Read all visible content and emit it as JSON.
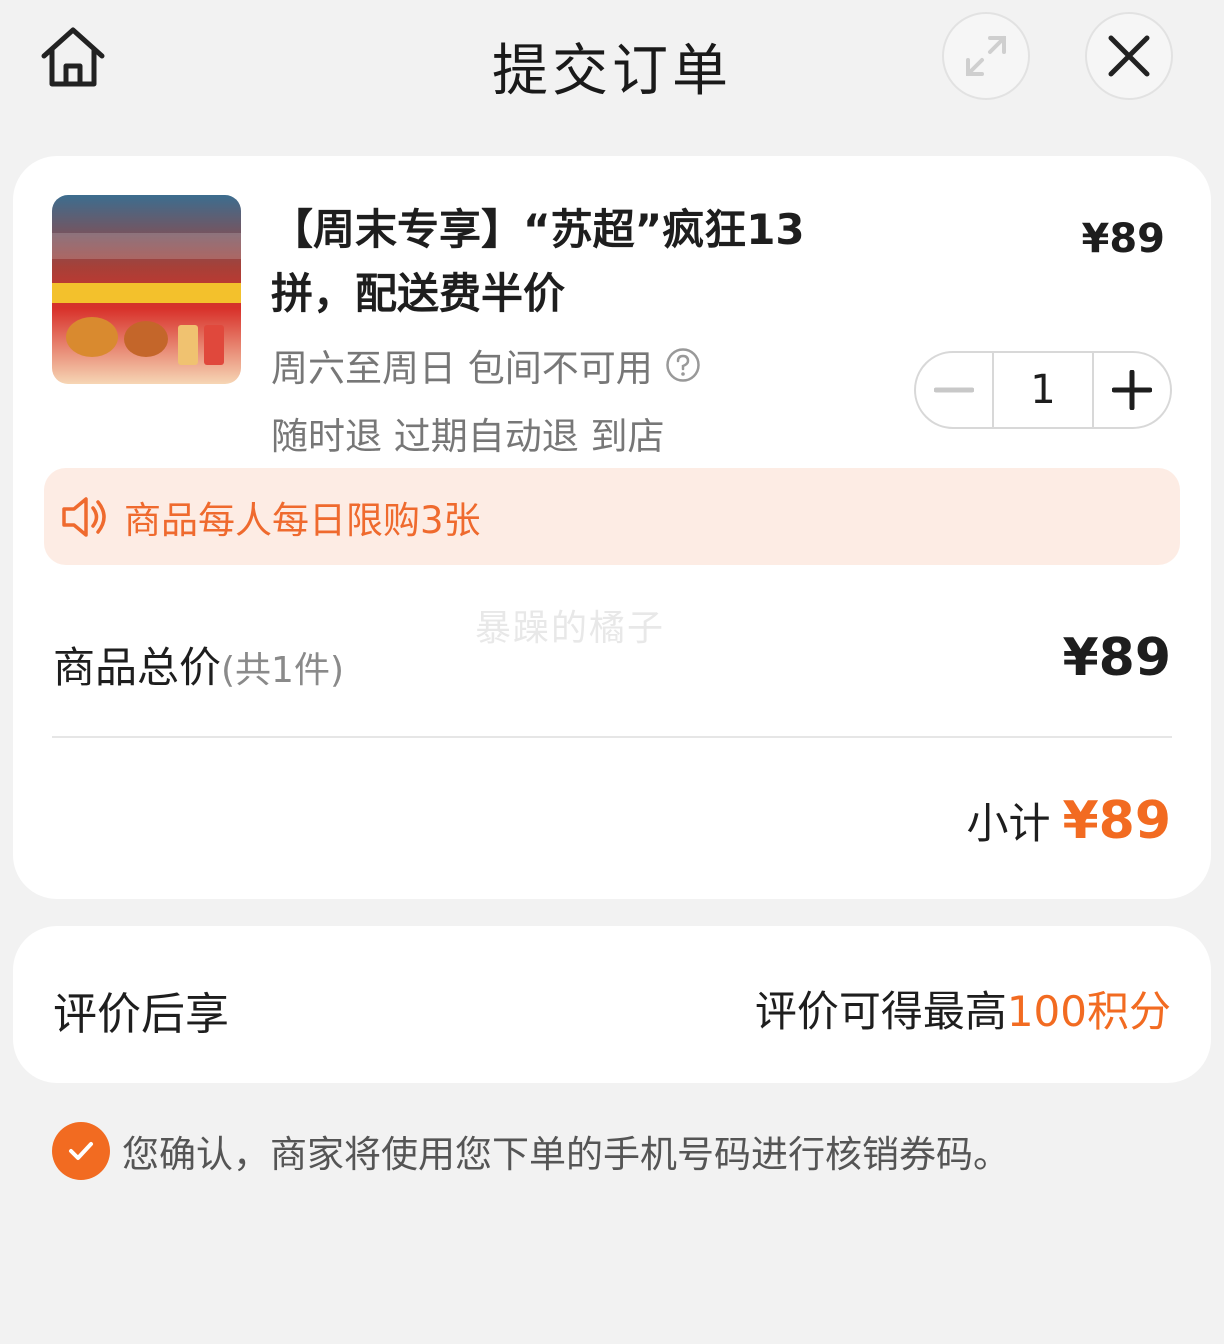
{
  "header": {
    "title": "提交订单",
    "home_icon": "home-icon",
    "expand_icon": "expand-icon",
    "close_icon": "close-icon"
  },
  "product": {
    "image_icon": "product-thumbnail",
    "title": "【周末专享】“苏超”疯狂13拼，配送费半价",
    "price": "¥89",
    "tags": "周六至周日 包间不可用",
    "help_icon": "question-circle-icon",
    "policies": "随时退 过期自动退 到店",
    "quantity": "1",
    "minus_icon": "minus-icon",
    "plus_icon": "plus-icon"
  },
  "notice": {
    "icon": "speaker-icon",
    "text": "商品每人每日限购3张"
  },
  "watermark": "暴躁的橘子",
  "summary": {
    "total_label": "商品总价",
    "total_count": "(共1件)",
    "total_value": "¥89",
    "subtotal_label": "小计",
    "subtotal_value": "¥89"
  },
  "rating": {
    "label": "评价后享",
    "note_prefix": "评价可得最高",
    "note_points": "100积分"
  },
  "confirm": {
    "checked": true,
    "check_icon": "checkmark-icon",
    "text": "您确认，商家将使用您下单的手机号码进行核销券码。"
  },
  "colors": {
    "accent": "#f26b21",
    "notice_bg": "#fdece4",
    "page_bg": "#f2f2f2"
  }
}
